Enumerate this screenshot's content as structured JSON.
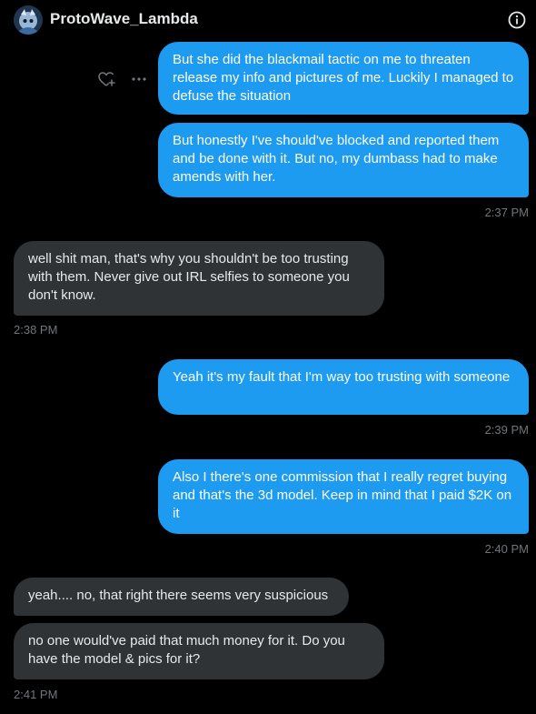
{
  "header": {
    "title": "ProtoWave_Lambda",
    "avatar_icon": "avatar-image",
    "info_icon": "info-icon"
  },
  "message_actions": {
    "react_icon": "heart-plus-icon",
    "more_icon": "more-horizontal-icon"
  },
  "messages": [
    {
      "side": "sent",
      "text": "But she did the blackmail tactic on me to threaten release my info and pictures of me. Luckily I managed to defuse the situation"
    },
    {
      "side": "sent",
      "text": "But honestly I've should've blocked and reported them and be done with it. But no, my dumbass had to make amends with her.",
      "time": "2:37 PM"
    },
    {
      "side": "received",
      "text": "well shit man, that's why you shouldn't be too trusting with them. Never give out IRL selfies to someone you don't know.",
      "time": "2:38 PM"
    },
    {
      "side": "sent",
      "text": "Yeah it's my fault that I'm way too trusting with someone",
      "time": "2:39 PM"
    },
    {
      "side": "sent",
      "text": "Also I there's one commission that I really regret buying and that's the 3d model. Keep in mind that I paid $2K on it",
      "time": "2:40 PM"
    },
    {
      "side": "received",
      "text": "yeah.... no, that right there seems very suspicious"
    },
    {
      "side": "received",
      "text": "no one would've paid that much money for it. Do you have the model & pics for it?",
      "time": "2:41 PM"
    }
  ],
  "colors": {
    "background": "#000000",
    "sent_bubble": "#1d9bf0",
    "received_bubble": "#2f3336",
    "timestamp": "#71767b",
    "text": "#e7e9ea"
  }
}
